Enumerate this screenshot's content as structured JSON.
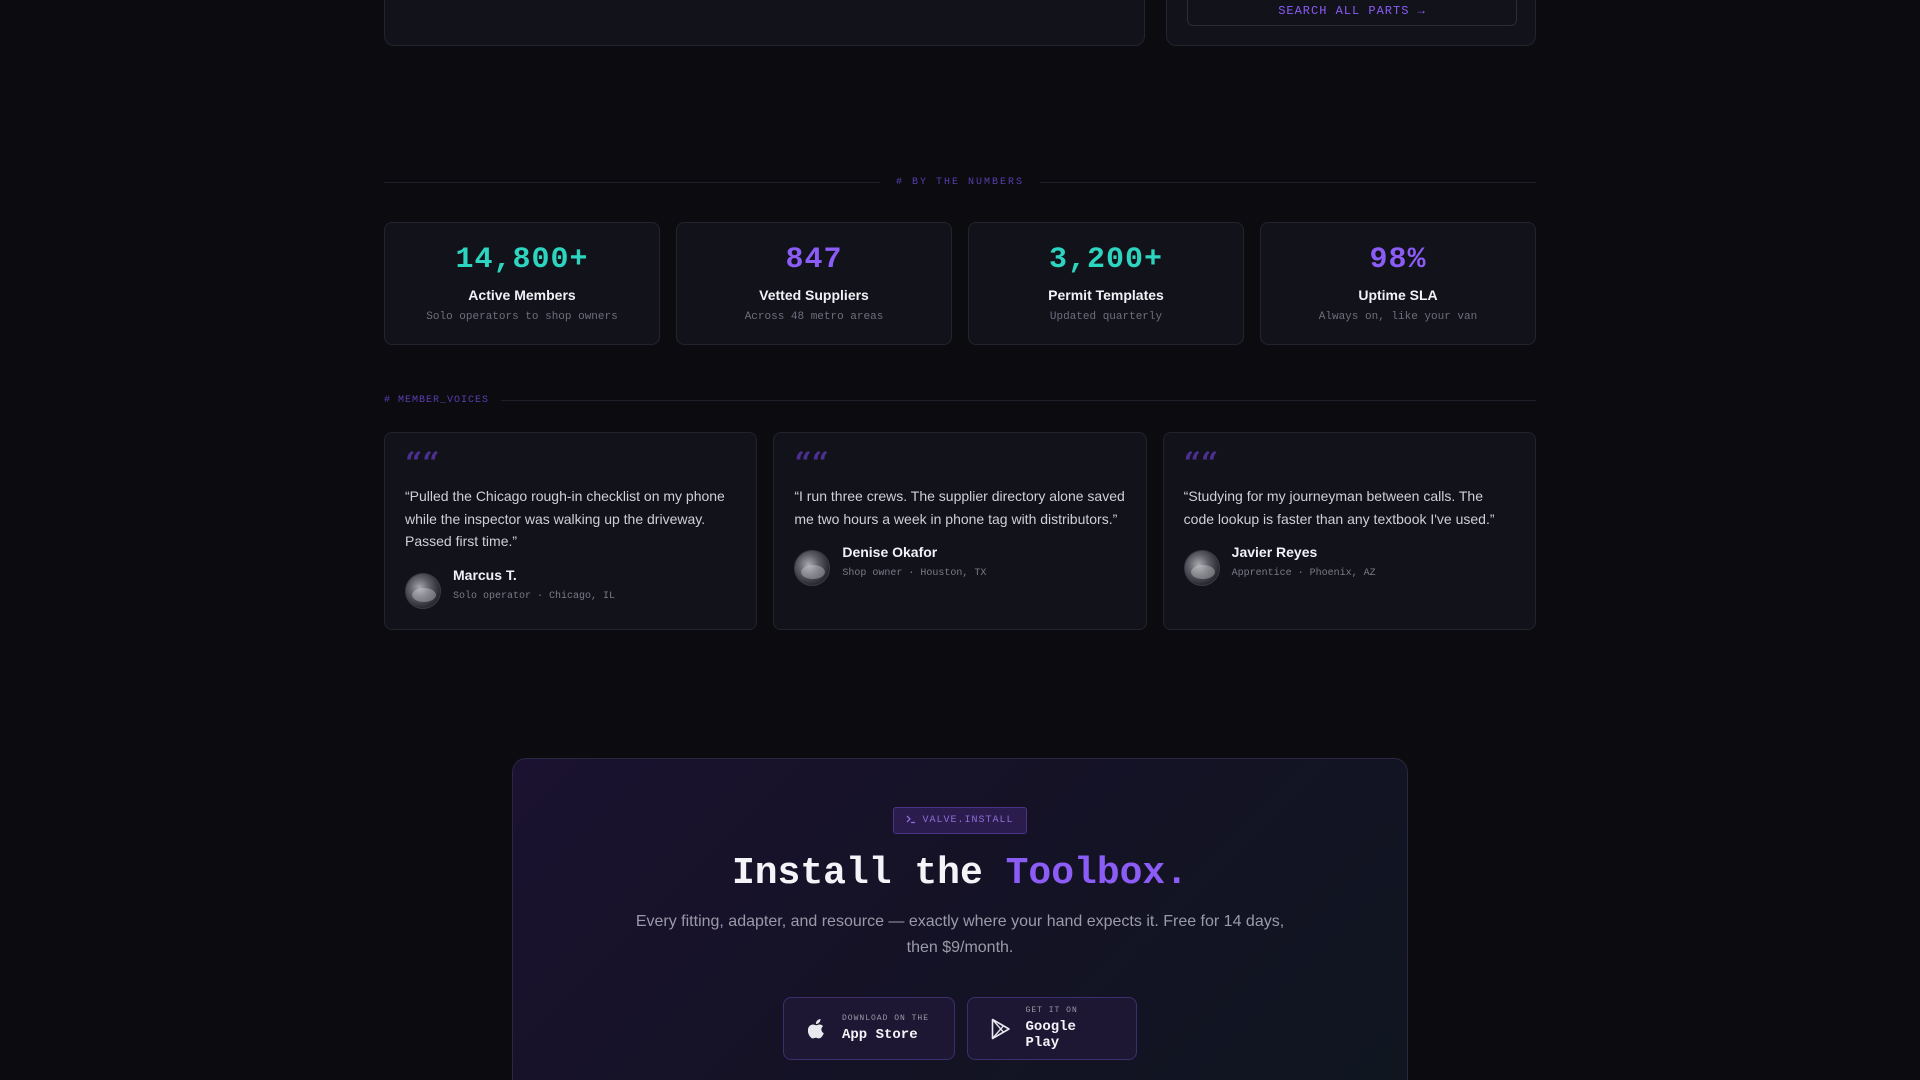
{
  "top_cards": {
    "search_parts_label": "SEARCH ALL PARTS →"
  },
  "numbers_section": {
    "heading": "# BY THE NUMBERS",
    "stats": [
      {
        "value": "14,800+",
        "label": "Active Members",
        "sub": "Solo operators to shop owners",
        "color": "#2dd4bf"
      },
      {
        "value": "847",
        "label": "Vetted Suppliers",
        "sub": "Across 48 metro areas",
        "color": "#8b5cf6"
      },
      {
        "value": "3,200+",
        "label": "Permit Templates",
        "sub": "Updated quarterly",
        "color": "#2dd4bf"
      },
      {
        "value": "98%",
        "label": "Uptime SLA",
        "sub": "Always on, like your van",
        "color": "#8b5cf6"
      }
    ]
  },
  "voices_section": {
    "heading": "# MEMBER_VOICES",
    "quote_mark": "““",
    "testimonials": [
      {
        "text": "“Pulled the Chicago rough-in checklist on my phone while the inspector was walking up the driveway. Passed first time.”",
        "name": "Marcus T.",
        "meta": "Solo operator · Chicago, IL"
      },
      {
        "text": "“I run three crews. The supplier directory alone saved me two hours a week in phone tag with distributors.”",
        "name": "Denise Okafor",
        "meta": "Shop owner · Houston, TX"
      },
      {
        "text": "“Studying for my journeyman between calls. The code lookup is faster than any textbook I've used.”",
        "name": "Javier Reyes",
        "meta": "Apprentice · Phoenix, AZ"
      }
    ]
  },
  "cta": {
    "badge": "VALVE.INSTALL",
    "badge_icon": "terminal-icon",
    "title_main": "Install the ",
    "title_accent": "Toolbox.",
    "description": "Every fitting, adapter, and resource — exactly where your hand expects it. Free for 14 days, then $9/month.",
    "app_store": {
      "small": "DOWNLOAD ON THE",
      "big": "App Store",
      "icon": "apple-icon"
    },
    "google_play": {
      "small": "GET IT ON",
      "big": "Google Play",
      "icon": "play-icon"
    }
  }
}
